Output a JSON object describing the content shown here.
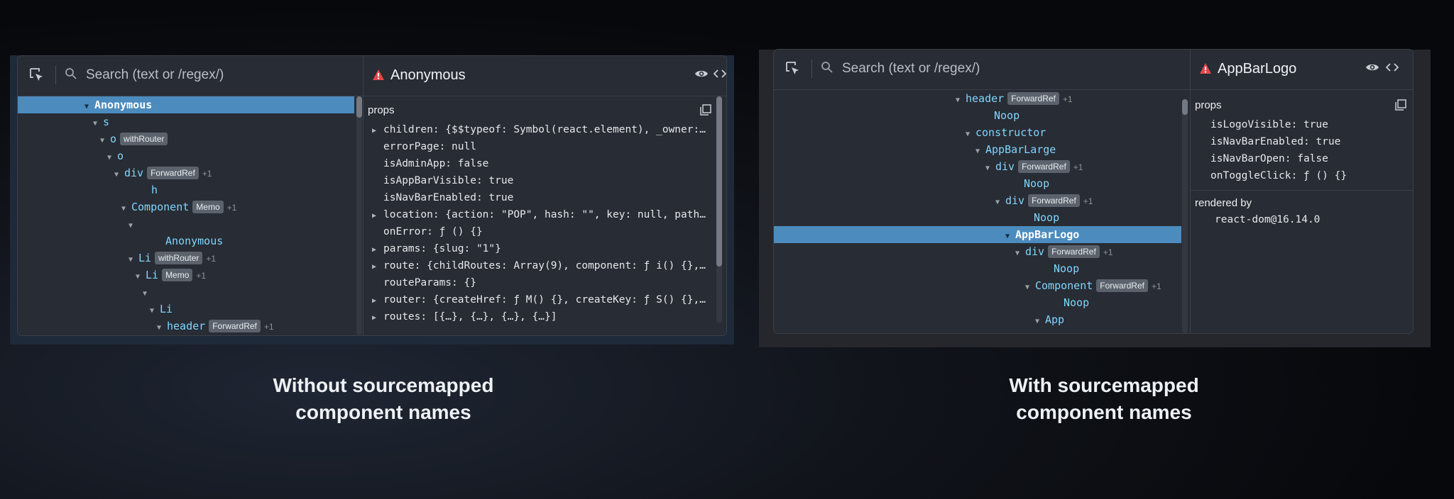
{
  "left": {
    "search_placeholder": "Search (text or /regex/)",
    "selected_component": "Anonymous",
    "props_label": "props",
    "tree": [
      {
        "name": "Anonymous",
        "indent": 108,
        "arrow": "down",
        "selected": true
      },
      {
        "name": "s",
        "indent": 120,
        "arrow": "down"
      },
      {
        "name": "o",
        "indent": 130,
        "arrow": "down",
        "badge": "withRouter"
      },
      {
        "name": "o",
        "indent": 140,
        "arrow": "down"
      },
      {
        "name": "div",
        "indent": 150,
        "arrow": "down",
        "badge": "ForwardRef",
        "extra": "+1"
      },
      {
        "name": "h",
        "indent": 174,
        "arrow": "none"
      },
      {
        "name": "Component",
        "indent": 160,
        "arrow": "down",
        "badge": "Memo",
        "extra": "+1"
      },
      {
        "name": "",
        "indent": 170,
        "arrow": "down"
      },
      {
        "name": "Anonymous",
        "indent": 194,
        "arrow": "none"
      },
      {
        "name": "Li",
        "indent": 170,
        "arrow": "down",
        "badge": "withRouter",
        "extra": "+1"
      },
      {
        "name": "Li",
        "indent": 180,
        "arrow": "down",
        "badge": "Memo",
        "extra": "+1"
      },
      {
        "name": "",
        "indent": 190,
        "arrow": "down"
      },
      {
        "name": "Li",
        "indent": 200,
        "arrow": "down"
      },
      {
        "name": "header",
        "indent": 210,
        "arrow": "down",
        "badge": "ForwardRef",
        "extra": "+1"
      }
    ],
    "props": [
      {
        "text": "children: {$$typeof: Symbol(react.element), _owner:…",
        "expand": true
      },
      {
        "text": "errorPage: null",
        "expand": false
      },
      {
        "text": "isAdminApp: false",
        "expand": false
      },
      {
        "text": "isAppBarVisible: true",
        "expand": false
      },
      {
        "text": "isNavBarEnabled: true",
        "expand": false
      },
      {
        "text": "location: {action: \"POP\", hash: \"\", key: null, path…",
        "expand": true
      },
      {
        "text": "onError: ƒ () {}",
        "expand": false
      },
      {
        "text": "params: {slug: \"1\"}",
        "expand": true
      },
      {
        "text": "route: {childRoutes: Array(9), component: ƒ i() {},…",
        "expand": true
      },
      {
        "text": "routeParams: {}",
        "expand": false
      },
      {
        "text": "router: {createHref: ƒ M() {}, createKey: ƒ S() {},…",
        "expand": true
      },
      {
        "text": "routes: [{…}, {…}, {…}, {…}]",
        "expand": true
      }
    ],
    "caption": [
      "Without sourcemapped",
      "component names"
    ]
  },
  "right": {
    "search_placeholder": "Search (text or /regex/)",
    "selected_component": "AppBarLogo",
    "props_label": "props",
    "rendered_by_label": "rendered by",
    "rendered_by_value": "react-dom@16.14.0",
    "tree": [
      {
        "name": "header",
        "indent": 270,
        "arrow": "down",
        "badge": "ForwardRef",
        "extra": "+1"
      },
      {
        "name": "Noop",
        "indent": 296,
        "arrow": "none"
      },
      {
        "name": "constructor",
        "indent": 284,
        "arrow": "down"
      },
      {
        "name": "AppBarLarge",
        "indent": 298,
        "arrow": "down"
      },
      {
        "name": "div",
        "indent": 312,
        "arrow": "down",
        "badge": "ForwardRef",
        "extra": "+1"
      },
      {
        "name": "Noop",
        "indent": 338,
        "arrow": "none"
      },
      {
        "name": "div",
        "indent": 326,
        "arrow": "down",
        "badge": "ForwardRef",
        "extra": "+1"
      },
      {
        "name": "Noop",
        "indent": 352,
        "arrow": "none"
      },
      {
        "name": "AppBarLogo",
        "indent": 340,
        "arrow": "down",
        "selected": true
      },
      {
        "name": "div",
        "indent": 354,
        "arrow": "down",
        "badge": "ForwardRef",
        "extra": "+1"
      },
      {
        "name": "Noop",
        "indent": 380,
        "arrow": "none"
      },
      {
        "name": "Component",
        "indent": 368,
        "arrow": "down",
        "badge": "ForwardRef",
        "extra": "+1"
      },
      {
        "name": "Noop",
        "indent": 394,
        "arrow": "none"
      },
      {
        "name": "App",
        "indent": 382,
        "arrow": "down"
      }
    ],
    "props": [
      {
        "text": "isLogoVisible: true"
      },
      {
        "text": "isNavBarEnabled: true"
      },
      {
        "text": "isNavBarOpen: false"
      },
      {
        "text": "onToggleClick: ƒ () {}"
      }
    ],
    "caption": [
      "With sourcemapped",
      "component names"
    ]
  },
  "icons": [
    "select-element-icon",
    "search-icon",
    "warning-icon",
    "eye-icon",
    "code-icon",
    "copy-icon"
  ],
  "colors": {
    "selected_row": "#4b8bbe",
    "component_name": "#7fd6ff",
    "warning": "#e5484d"
  }
}
